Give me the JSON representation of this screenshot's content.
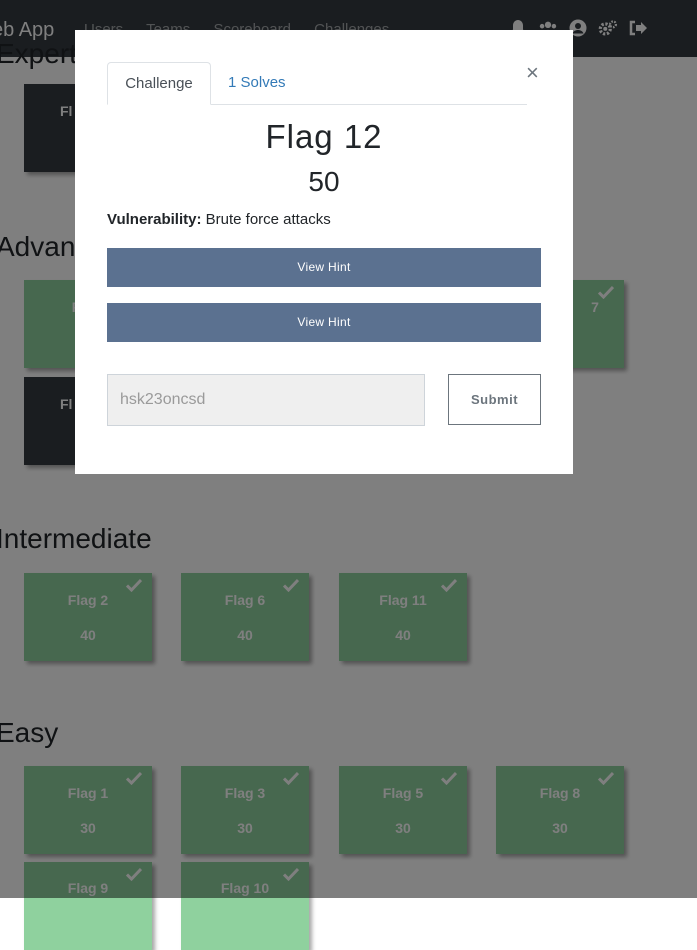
{
  "navbar": {
    "brand": "eb App",
    "links": [
      "Users",
      "Teams",
      "Scoreboard",
      "Challenges"
    ],
    "icons": [
      "bell-icon",
      "users-icon",
      "user-circle-icon",
      "cogs-icon",
      "sign-out-icon"
    ]
  },
  "board": {
    "categories": {
      "expert": "Expert",
      "advanced": "Advanced",
      "intermediate": "Intermediate",
      "easy": "Easy"
    },
    "tiles": {
      "expert_1": {
        "name": "Fl"
      },
      "advanced_1": {
        "name": "Fl"
      },
      "advanced_2": {
        "name": "Fl"
      },
      "advanced_3": {
        "name": "7"
      },
      "intermediate_1": {
        "name": "Flag 2",
        "value": "40"
      },
      "intermediate_2": {
        "name": "Flag 6",
        "value": "40"
      },
      "intermediate_3": {
        "name": "Flag 11",
        "value": "40"
      },
      "easy_1": {
        "name": "Flag 1",
        "value": "30"
      },
      "easy_2": {
        "name": "Flag 3",
        "value": "30"
      },
      "easy_3": {
        "name": "Flag 5",
        "value": "30"
      },
      "easy_4": {
        "name": "Flag 8",
        "value": "30"
      },
      "easy_5": {
        "name": "Flag 9",
        "value": ""
      },
      "easy_6": {
        "name": "Flag 10",
        "value": ""
      }
    },
    "colors": {
      "solved": "#8fd19e",
      "unsolved": "#343a40"
    }
  },
  "modal": {
    "close_label": "×",
    "tabs": {
      "challenge": "Challenge",
      "solves": "1 Solves"
    },
    "challenge_name": "Flag 12",
    "challenge_value": "50",
    "description_label": "Vulnerability:",
    "description_text": " Brute force attacks",
    "hint_buttons": [
      "View Hint",
      "View Hint"
    ],
    "answer_value": "hsk23oncsd",
    "submit_label": "Submit",
    "accent_color": "#5b7190"
  }
}
